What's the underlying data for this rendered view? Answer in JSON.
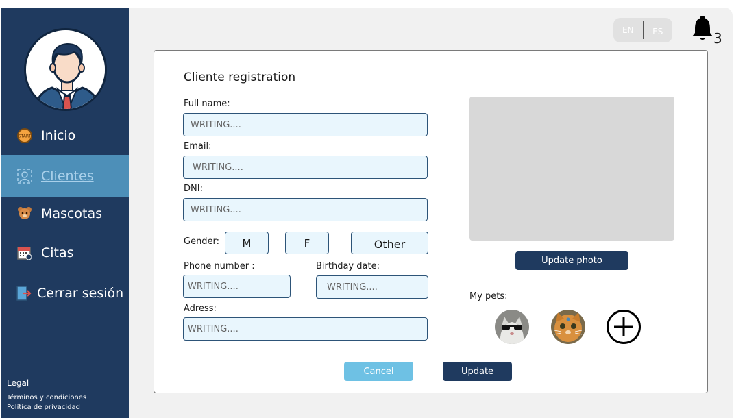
{
  "sidebar": {
    "nav": [
      {
        "label": "Inicio",
        "icon": "start-icon"
      },
      {
        "label": "Clientes",
        "icon": "clients-icon",
        "active": true
      },
      {
        "label": "Mascotas",
        "icon": "bear-icon"
      },
      {
        "label": "Citas",
        "icon": "calendar-icon"
      },
      {
        "label": "Cerrar sesión",
        "icon": "logout-icon"
      }
    ],
    "legal": {
      "title": "Legal",
      "terms": "Términos y condiciones",
      "privacy": "Política de privacidad"
    }
  },
  "header": {
    "lang_en": "EN",
    "lang_es": "ES",
    "notifications_count": "3"
  },
  "form": {
    "title": "Cliente registration",
    "full_name_label": "Full name:",
    "email_label": "Email:",
    "dni_label": "DNI:",
    "gender_label": "Gender:",
    "gender_options": [
      "M",
      "F",
      "Other"
    ],
    "phone_label": "Phone number :",
    "birthday_label": "Birthday date:",
    "address_label": "Adress:",
    "placeholder": "WRITING...."
  },
  "photo": {
    "update_label": "Update photo"
  },
  "pets": {
    "label": "My pets:"
  },
  "actions": {
    "cancel": "Cancel",
    "update": "Update"
  },
  "colors": {
    "sidebar": "#1f3a5f",
    "active_nav": "#4d8fb8",
    "primary_button": "#1f3a5f",
    "cancel_button": "#6ec1e4",
    "input_bg": "#e9f6fd"
  }
}
